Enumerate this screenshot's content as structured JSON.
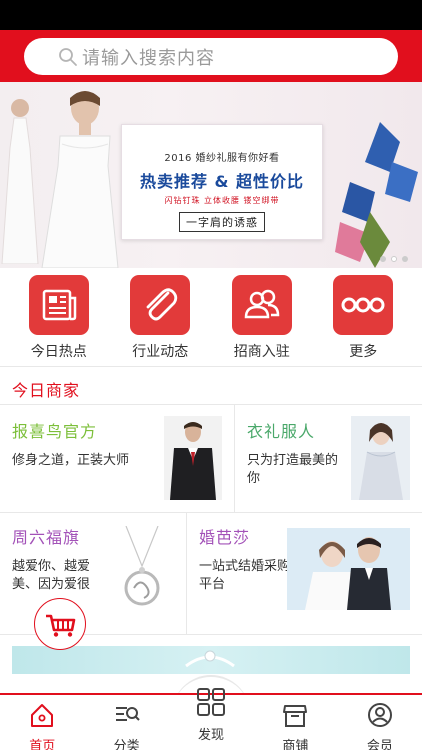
{
  "search": {
    "placeholder": "请输入搜索内容"
  },
  "banner": {
    "line1": "2016 婚纱礼服有你好看",
    "line2": "热卖推荐 & 超性价比",
    "line3": "闪钻钉珠  立体收腰  镂空绑带",
    "line4": "一字肩的诱惑",
    "page_count": 3,
    "active_page": 2
  },
  "nav": [
    {
      "label": "今日热点",
      "icon": "newspaper-icon"
    },
    {
      "label": "行业动态",
      "icon": "paperclip-icon"
    },
    {
      "label": "招商入驻",
      "icon": "users-icon"
    },
    {
      "label": "更多",
      "icon": "more-dots-icon"
    }
  ],
  "section": {
    "title": "今日商家"
  },
  "merchants": [
    {
      "name": "报喜鸟官方",
      "desc": "修身之道，正装大师",
      "name_color": "#7cbf3a"
    },
    {
      "name": "衣礼服人",
      "desc": "只为打造最美的你",
      "name_color": "#4aa86a"
    },
    {
      "name": "周六福旗",
      "desc": "越爱你、越爱美、因为爱很",
      "name_color": "#a352b8"
    },
    {
      "name": "婚芭莎",
      "desc": "一站式结婚采购平台",
      "name_color": "#a352b8"
    }
  ],
  "tabs": [
    {
      "label": "首页",
      "icon": "home-icon",
      "active": true
    },
    {
      "label": "分类",
      "icon": "category-icon",
      "active": false
    },
    {
      "label": "发现",
      "icon": "grid-icon",
      "active": false
    },
    {
      "label": "商铺",
      "icon": "shop-icon",
      "active": false
    },
    {
      "label": "会员",
      "icon": "user-icon",
      "active": false
    }
  ],
  "colors": {
    "brand": "#e10f1d",
    "icon_red": "#e23a3a"
  }
}
